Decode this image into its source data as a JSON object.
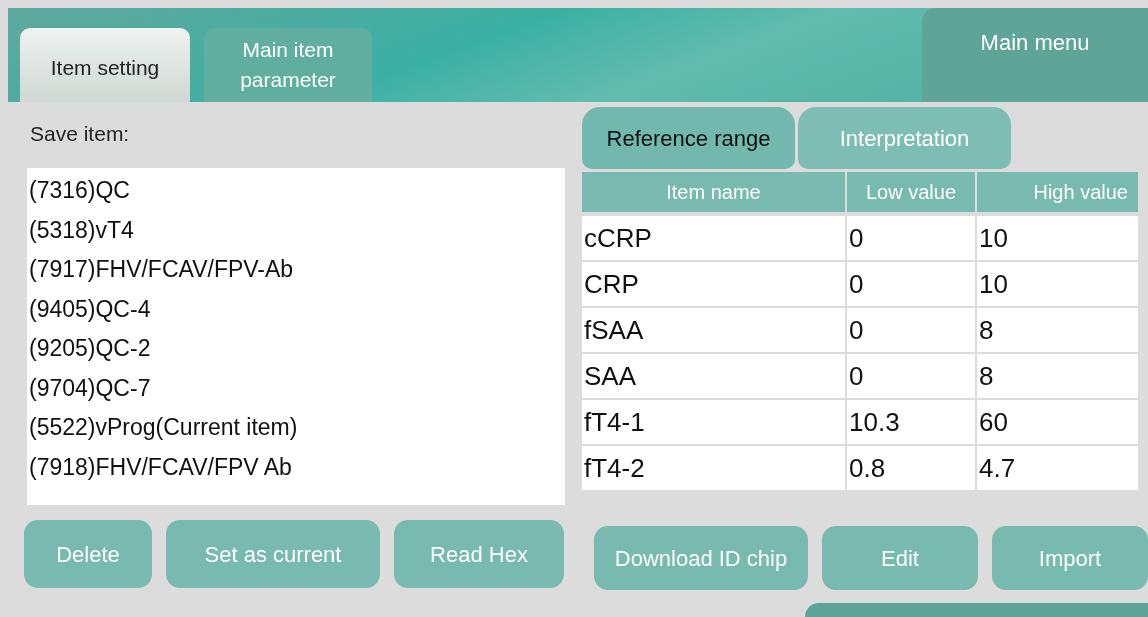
{
  "tabs": [
    {
      "label": "Item setting",
      "selected": true
    },
    {
      "label": "Main item\nparameter",
      "selected": false
    }
  ],
  "main_menu": "Main menu",
  "save_item": {
    "label": "Save item:",
    "items": [
      "(7316)QC",
      "(5318)vT4",
      "(7917)FHV/FCAV/FPV-Ab",
      "(9405)QC-4",
      "(9205)QC-2",
      "(9704)QC-7",
      "(5522)vProg(Current item)",
      "(7918)FHV/FCAV/FPV Ab"
    ]
  },
  "left_buttons": [
    "Delete",
    "Set as current",
    "Read Hex"
  ],
  "sub_tabs": [
    {
      "label": "Reference range",
      "selected": true
    },
    {
      "label": "Interpretation",
      "selected": false
    }
  ],
  "table": {
    "columns": [
      "Item name",
      "Low value",
      "High value"
    ],
    "rows": [
      [
        "cCRP",
        "0",
        "10"
      ],
      [
        "CRP",
        "0",
        "10"
      ],
      [
        "fSAA",
        "0",
        "8"
      ],
      [
        "SAA",
        "0",
        "8"
      ],
      [
        "fT4-1",
        "10.3",
        "60"
      ],
      [
        "fT4-2",
        "0.8",
        "4.7"
      ]
    ]
  },
  "right_buttons": [
    "Download ID chip",
    "Edit",
    "Import"
  ]
}
